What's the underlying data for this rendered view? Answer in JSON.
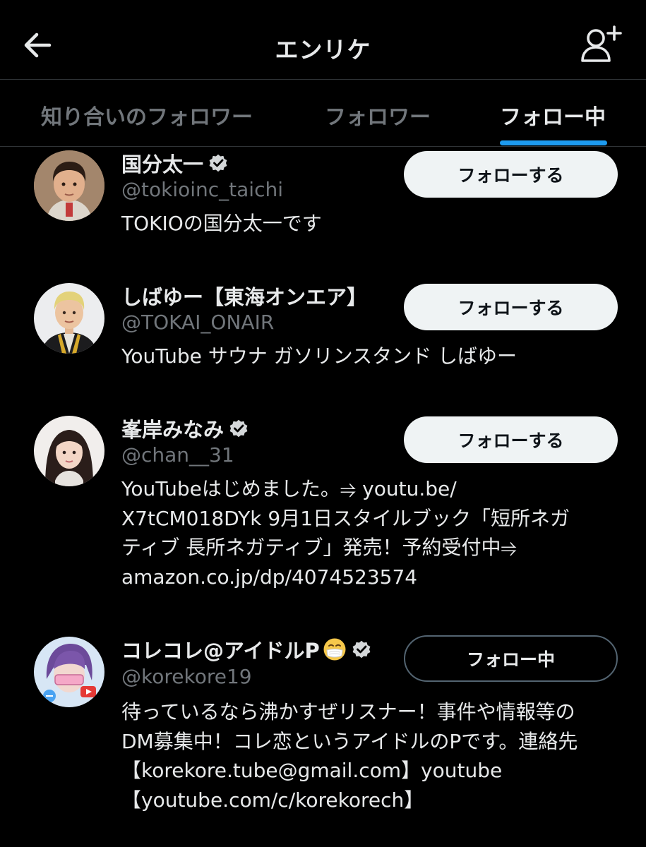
{
  "header": {
    "title": "エンリケ",
    "back_icon": "arrow-left-icon",
    "add_icon": "add-person-icon"
  },
  "tabs": [
    {
      "label": "知り合いのフォロワー",
      "active": false
    },
    {
      "label": "フォロワー",
      "active": false
    },
    {
      "label": "フォロー中",
      "active": true
    }
  ],
  "accent_color": "#1d9bf0",
  "users": [
    {
      "name": "国分太一",
      "verified": true,
      "handle": "@tokioinc_taichi",
      "bio_lines": [
        "TOKIOの国分太一です"
      ],
      "button_label": "フォローする"
    },
    {
      "name": "しばゆー【東海オンエア】",
      "verified": false,
      "handle": "@TOKAI_ONAIR",
      "bio_lines": [
        "YouTube サウナ ガソリンスタンド しばゆー"
      ],
      "button_label": "フォローする"
    },
    {
      "name": "峯岸みなみ",
      "verified": true,
      "handle": "@chan__31",
      "bio_lines": [
        "YouTubeはじめました。⥤ youtu.be/",
        "X7tCM018DYk 9月1日スタイルブック「短所ネガ",
        "ティブ 長所ネガティブ」発売！予約受付中⥤",
        "amazon.co.jp/dp/4074523574"
      ],
      "button_label": "フォローする"
    },
    {
      "name": "コレコレ@アイドルP",
      "verified": true,
      "emoji": "😷",
      "handle": "@korekore19",
      "bio_lines": [
        "待っているなら沸かすぜリスナー！事件や情報等の",
        "DM募集中！コレ恋というアイドルのPです。連絡先",
        "【korekore.tube@gmail.com】youtube",
        "【youtube.com/c/korekorech】"
      ],
      "button_label": "フォロー中"
    }
  ]
}
